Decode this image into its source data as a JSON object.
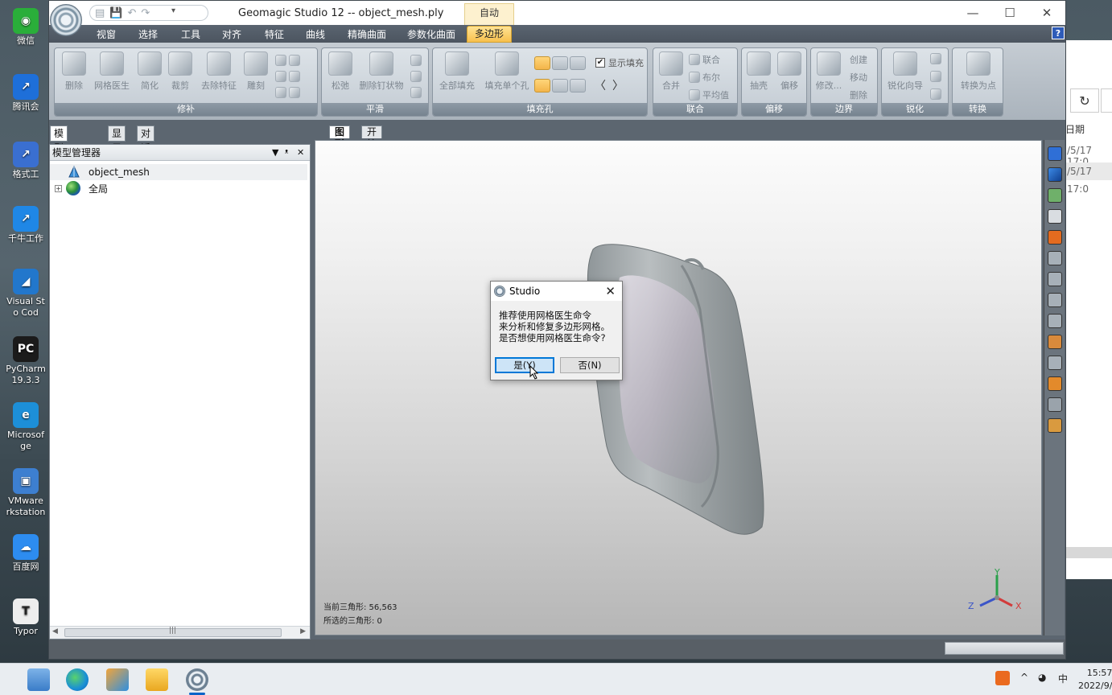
{
  "desktop": {
    "icons": [
      {
        "label": "微信",
        "color": "#2aae3a",
        "glyph": "◉"
      },
      {
        "label": "腾讯会",
        "color": "#1e6fd9",
        "glyph": "↗"
      },
      {
        "label": "格式工",
        "color": "#3a6fd0",
        "glyph": "↗"
      },
      {
        "label": "千牛工作",
        "color": "#1f87e6",
        "glyph": "↗"
      },
      {
        "label": "Visual St\no Cod",
        "color": "#2277cc",
        "glyph": "◢"
      },
      {
        "label": "PyCharm\n19.3.3",
        "color": "#1b1b1b",
        "glyph": "PC"
      },
      {
        "label": "Microsof\nge",
        "color": "#1d8fd8",
        "glyph": "e"
      },
      {
        "label": "VMware\nrkstation",
        "color": "#3d7fd0",
        "glyph": "▣"
      },
      {
        "label": "百度网",
        "color": "#2d8cf0",
        "glyph": "☁"
      },
      {
        "label": "Typor",
        "color": "#eeeeee",
        "glyph": "T"
      }
    ]
  },
  "background_window": {
    "refresh_icon": "refresh-icon",
    "header": "日期",
    "rows": [
      "/5/17 17:0",
      "/5/17 17:0"
    ]
  },
  "app": {
    "title": "Geomagic Studio 12 -- object_mesh.ply",
    "context_tab": "自动",
    "window_controls": {
      "minimize": "—",
      "maximize": "☐",
      "close": "✕"
    },
    "help_label": "?",
    "qat_more": "▾",
    "ribbon_tabs": [
      "视窗",
      "选择",
      "工具",
      "对齐",
      "特征",
      "曲线",
      "精确曲面",
      "参数化曲面",
      "多边形"
    ],
    "active_tab": "多边形",
    "groups": {
      "repair": {
        "label": "修补",
        "buttons": [
          "删除",
          "网格医生",
          "简化",
          "裁剪",
          "去除特征",
          "雕刻"
        ]
      },
      "smooth": {
        "label": "平滑",
        "buttons": [
          "松弛",
          "删除钉状物"
        ]
      },
      "fill": {
        "label": "填充孔",
        "buttons": [
          "全部填充",
          "填充单个孔"
        ],
        "checkbox_label": "显示填充",
        "checkbox_checked": true
      },
      "combine": {
        "label": "联合",
        "buttons": [
          "合并"
        ],
        "small_buttons": [
          "联合",
          "布尔",
          "平均值"
        ]
      },
      "offset": {
        "label": "偏移",
        "buttons": [
          "抽壳",
          "偏移"
        ]
      },
      "boundary": {
        "label": "边界",
        "buttons": [
          "修改..."
        ],
        "small_buttons": [
          "创建",
          "移动",
          "删除"
        ]
      },
      "sharpen": {
        "label": "锐化",
        "buttons": [
          "锐化向导"
        ]
      },
      "convert": {
        "label": "转换",
        "buttons": [
          "转换为点"
        ]
      }
    },
    "left_tabs": [
      "模型管理器",
      "显示",
      "对话框"
    ],
    "left_panel": {
      "title": "模型管理器",
      "pin": "📌",
      "close": "✕",
      "dropdown": "▼",
      "tree": [
        {
          "label": "object_mesh",
          "icon": "mesh-icon",
          "expander": ""
        },
        {
          "label": "全局",
          "icon": "globe-icon",
          "expander": "+"
        }
      ]
    },
    "view_tabs": [
      "图形",
      "开始"
    ],
    "viewport_info": {
      "current_triangles": "当前三角形: 56,563",
      "selected_triangles": "所选的三角形: 0"
    },
    "axes": {
      "x": "X",
      "y": "Y",
      "z": "Z"
    },
    "right_toolbar_icons": [
      "view-cube-icon",
      "viewport-icon",
      "layers-icon",
      "zoom-icon",
      "target-icon",
      "rect-select-icon",
      "lasso-icon",
      "line-select-icon",
      "brush-icon",
      "paint-icon",
      "polyline-icon",
      "flag-icon",
      "flag2-icon",
      "render-icon"
    ],
    "accent_color": "#f7c04d"
  },
  "dialog": {
    "title": "Studio",
    "close": "✕",
    "message": "推荐使用网格医生命令\n来分析和修复多边形网格。\n是否想使用网格医生命令?",
    "yes": "是(Y)",
    "no": "否(N)"
  },
  "taskbar": {
    "apps": [
      "task-view-icon",
      "edge-icon",
      "window-manager-icon",
      "file-explorer-icon",
      "geomagic-icon"
    ],
    "tray": {
      "chevron": "^",
      "ime": "中"
    },
    "time": "15:57",
    "date": "2022/9/"
  }
}
